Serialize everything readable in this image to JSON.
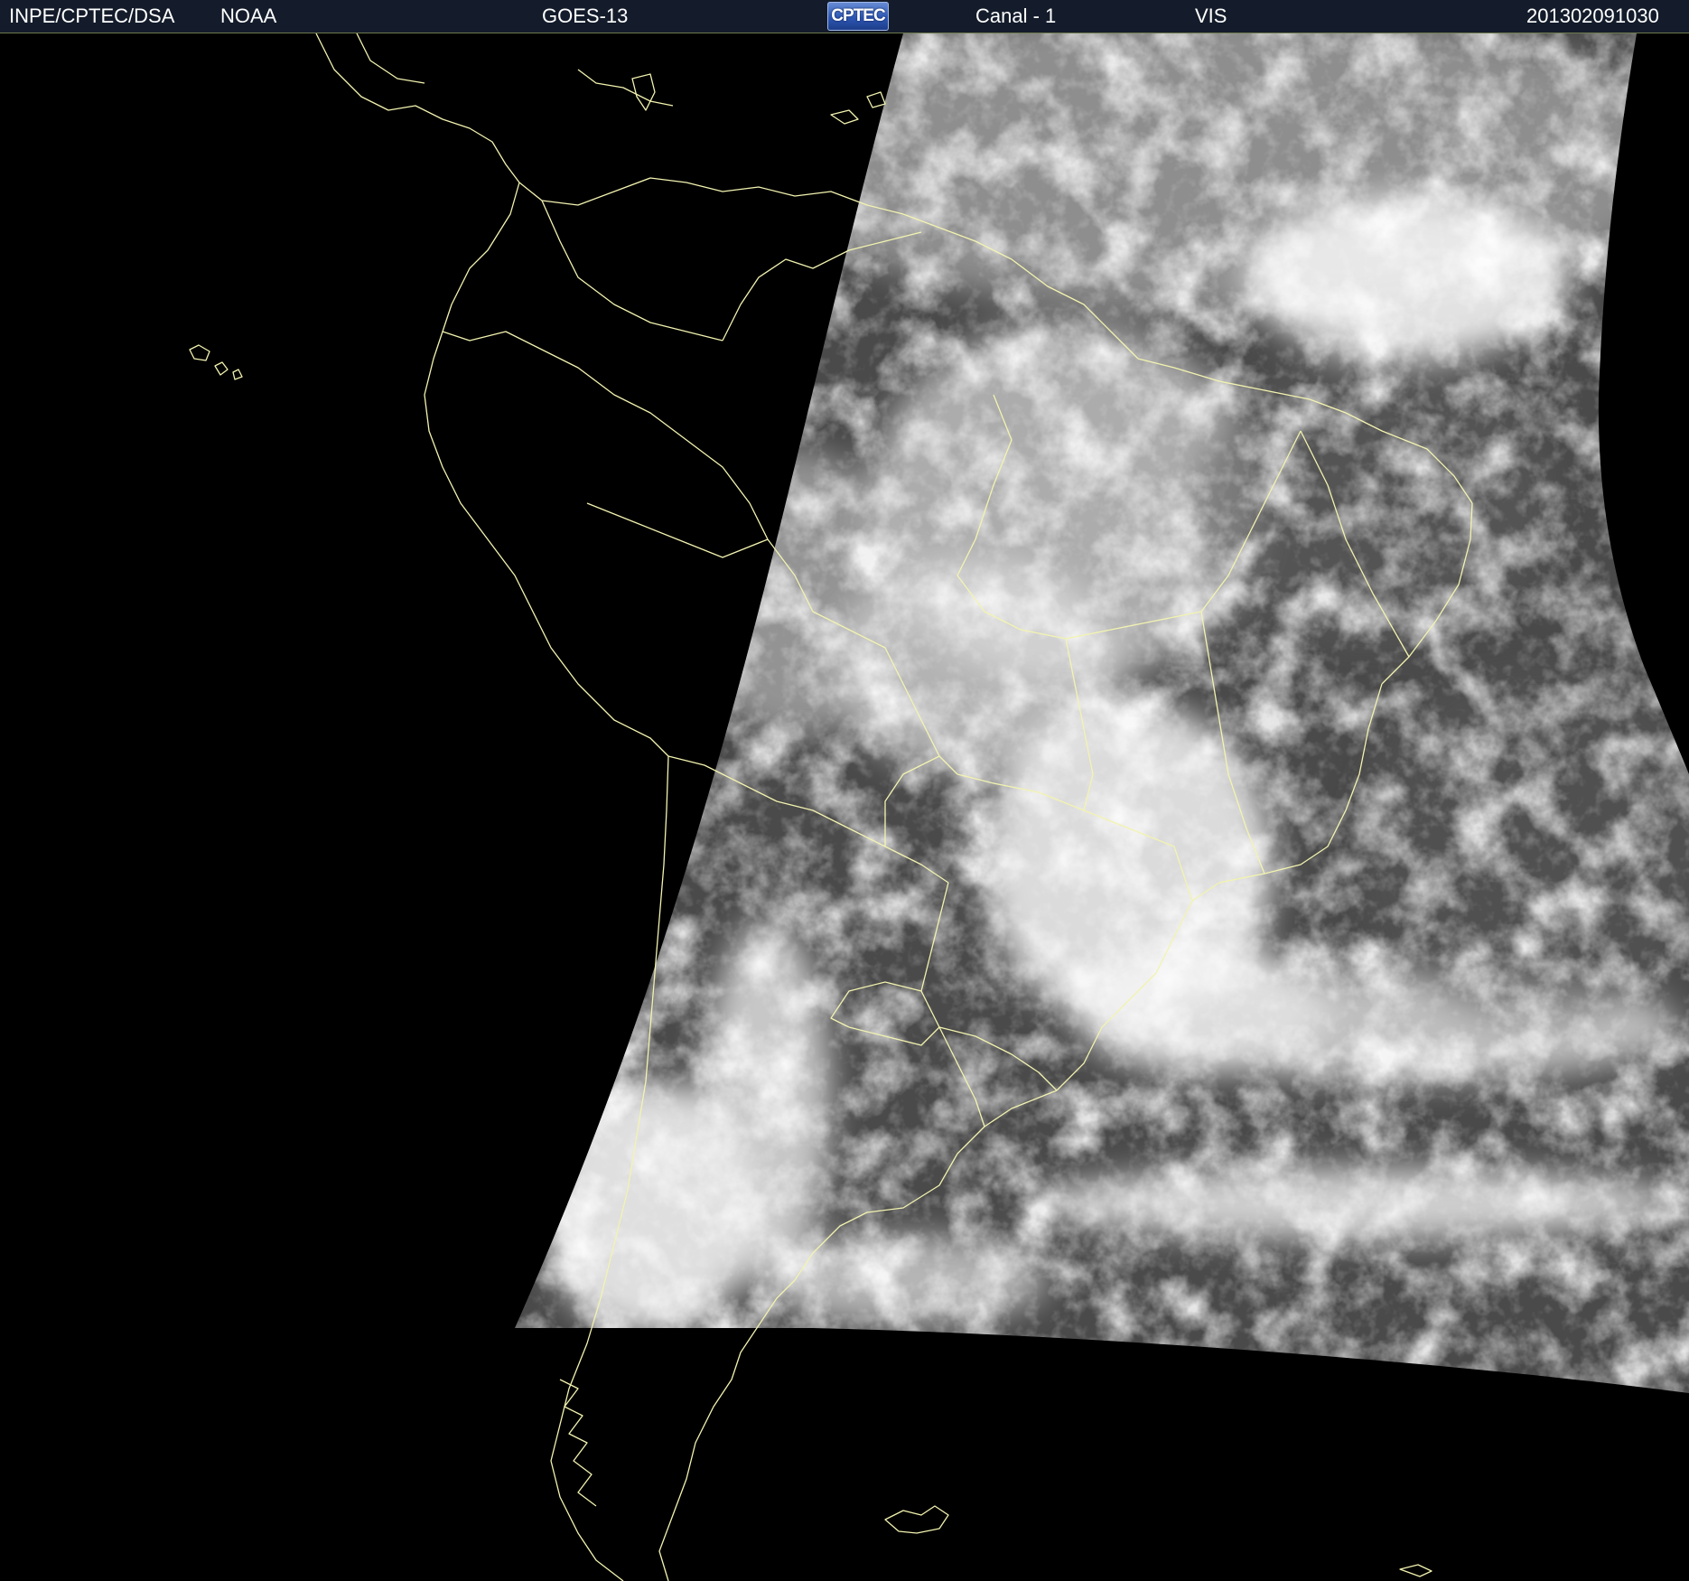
{
  "header": {
    "agency": "INPE/CPTEC/DSA",
    "source": "NOAA",
    "satellite": "GOES-13",
    "logo_text": "CPTEC",
    "channel": "Canal - 1",
    "band": "VIS",
    "timestamp": "201302091030"
  },
  "colors": {
    "header_bg": "#141c2b",
    "space_bg": "#000000",
    "coastline": "#f3f3b0",
    "cloud_white": "#f4f4f4",
    "earth_gray": "#555555"
  },
  "map": {
    "type": "satellite-visible-image",
    "region": "South America",
    "overlay": "political borders and coastlines"
  }
}
